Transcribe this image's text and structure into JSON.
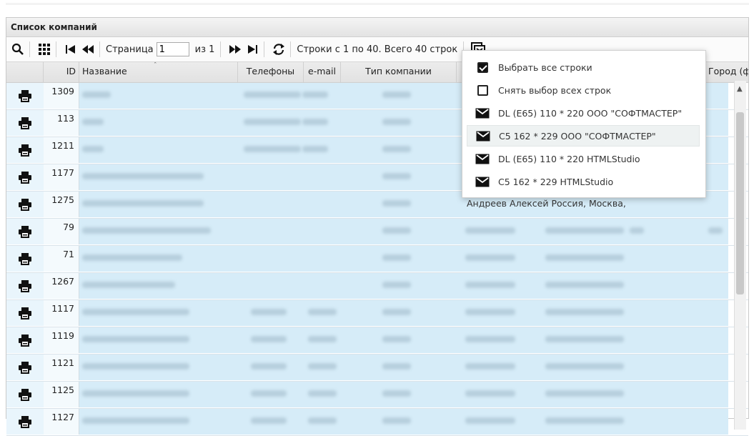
{
  "panel": {
    "title": "Список компаний"
  },
  "toolbar": {
    "page_label": "Страница",
    "page_value": "1",
    "page_of": "из 1",
    "rows_info": "Строки с 1 по 40. Всего 40 строк"
  },
  "columns": [
    "ID",
    "Название",
    "Телефоны",
    "e-mail",
    "Тип компании",
    "Город (ф"
  ],
  "rows": [
    {
      "id": "1309"
    },
    {
      "id": "113"
    },
    {
      "id": "1211"
    },
    {
      "id": "1177"
    },
    {
      "id": "1275",
      "clear_text": "Андреев Алексей Россия, Москва,"
    },
    {
      "id": "79"
    },
    {
      "id": "71"
    },
    {
      "id": "1267"
    },
    {
      "id": "1117"
    },
    {
      "id": "1119"
    },
    {
      "id": "1121"
    },
    {
      "id": "1125"
    },
    {
      "id": "1127"
    }
  ],
  "menu": {
    "items": [
      {
        "label": "Выбрать все строки",
        "icon": "checkbox-checked-icon"
      },
      {
        "label": "Снять выбор всех строк",
        "icon": "checkbox-empty-icon"
      },
      {
        "label": "DL (E65) 110 * 220 ООО \"СОФТМАСТЕР\"",
        "icon": "envelope-icon"
      },
      {
        "label": "C5 162 * 229 ООО \"СОФТМАСТЕР\"",
        "icon": "envelope-icon"
      },
      {
        "label": "DL (E65) 110 * 220 HTMLStudio",
        "icon": "envelope-icon"
      },
      {
        "label": "C5 162 * 229 HTMLStudio",
        "icon": "envelope-icon"
      }
    ]
  }
}
